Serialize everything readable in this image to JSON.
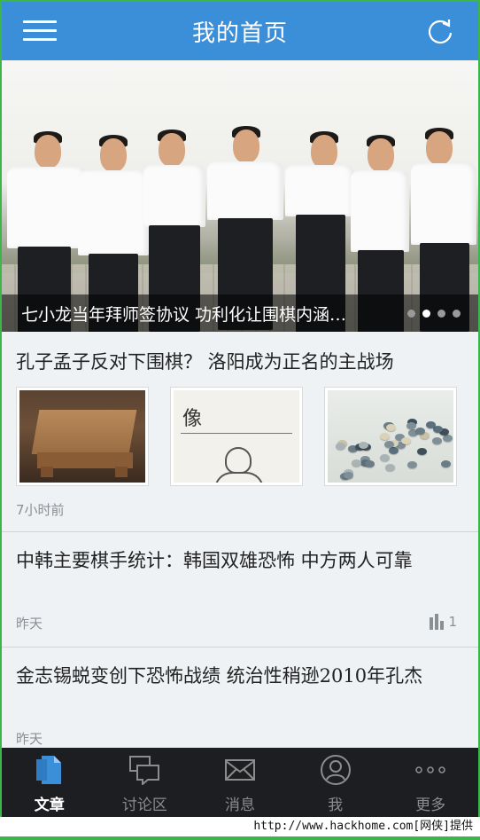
{
  "header": {
    "title": "我的首页",
    "menu_icon": "hamburger-menu-icon",
    "refresh_icon": "refresh-icon",
    "color": "#3b8fd9"
  },
  "banner": {
    "caption": "七小龙当年拜师签协议 功利化让围棋内涵…",
    "dots_total": 4,
    "dots_active_index": 1
  },
  "articles": [
    {
      "headline": "孔子孟子反对下围棋？ 洛阳成为正名的主战场",
      "time": "7小时前"
    },
    {
      "headline": "中韩主要棋手统计：韩国双雄恐怖 中方两人可靠",
      "time": "昨天",
      "stat_value": "1",
      "stat_icon": "bar-chart-icon"
    },
    {
      "headline": "金志锡蜕变创下恐怖战绩 统治性稍逊2010年孔杰",
      "time": "昨天"
    }
  ],
  "tabs": [
    {
      "label": "文章",
      "icon": "document-icon"
    },
    {
      "label": "讨论区",
      "icon": "chat-bubbles-icon"
    },
    {
      "label": "消息",
      "icon": "envelope-icon"
    },
    {
      "label": "我",
      "icon": "user-icon"
    },
    {
      "label": "更多",
      "icon": "more-dots-icon"
    }
  ],
  "watermark": "http://www.hackhome.com[网侠]提供"
}
